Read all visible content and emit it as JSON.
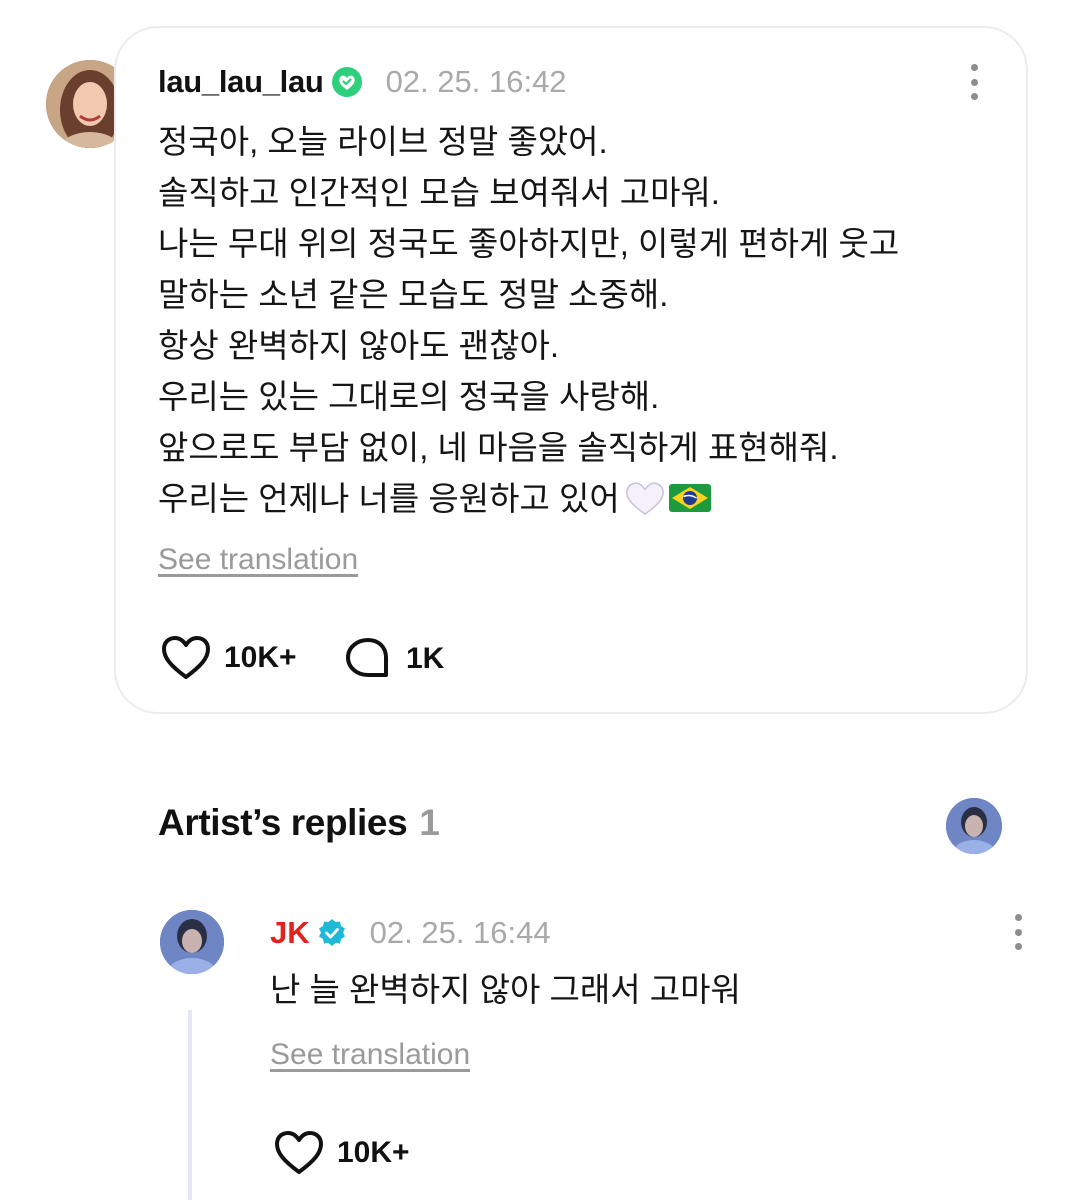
{
  "post": {
    "username": "lau_lau_lau",
    "timestamp": "02. 25. 16:42",
    "lines": [
      "정국아, 오늘 라이브 정말 좋았어.",
      "솔직하고 인간적인 모습 보여줘서 고마워.",
      "나는 무대 위의 정국도 좋아하지만, 이렇게 편하게 웃고",
      "말하는 소년 같은 모습도 정말 소중해.",
      "항상 완벽하지 않아도 괜찮아.",
      "우리는 있는 그대로의 정국을 사랑해.",
      "앞으로도 부담 없이, 네 마음을 솔직하게 표현해줘.",
      "우리는 언제나 너를 응원하고 있어"
    ],
    "emojis": [
      "white-heart",
      "brazil-flag"
    ],
    "see_translation": "See translation",
    "likes": "10K+",
    "comments": "1K"
  },
  "artist_replies": {
    "title": "Artist’s replies",
    "count": "1"
  },
  "reply": {
    "name": "JK",
    "timestamp": "02. 25. 16:44",
    "text": "난 늘 완벽하지 않아 그래서 고마워",
    "see_translation": "See translation",
    "likes": "10K+"
  },
  "colors": {
    "verified_green": "#2ecf7d",
    "verified_blue": "#1fb8d8",
    "artist_name": "#e0231e",
    "muted": "#a9a9a9"
  }
}
